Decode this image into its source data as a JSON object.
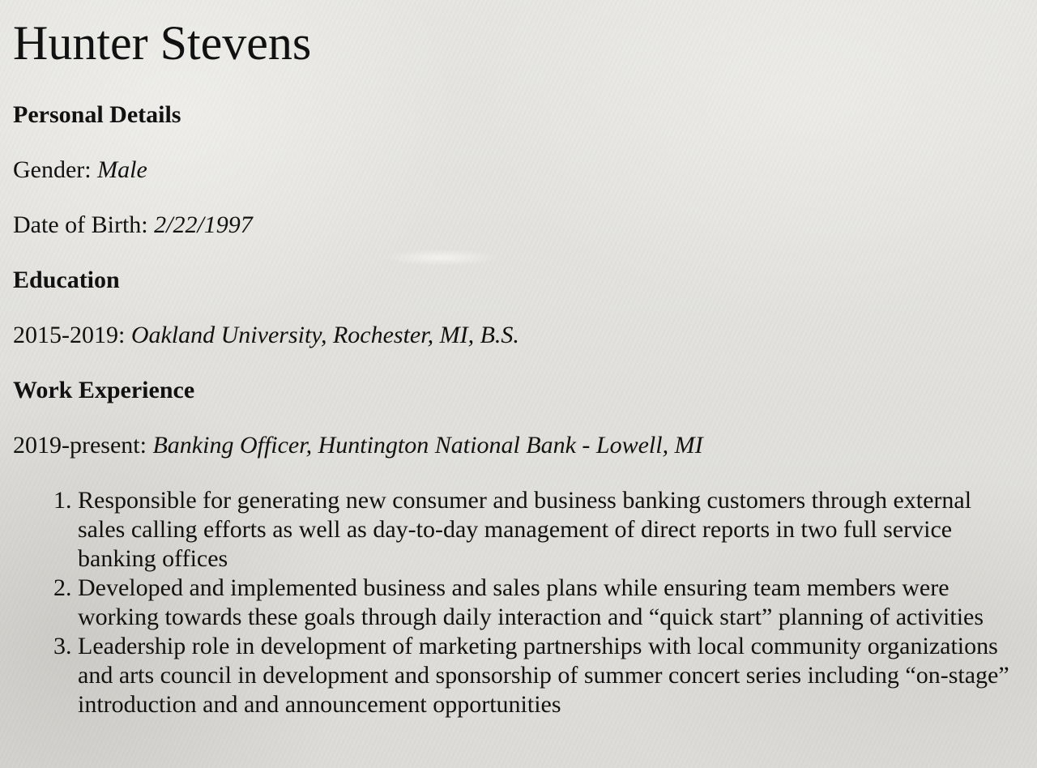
{
  "resume": {
    "name": "Hunter Stevens",
    "personal": {
      "heading": "Personal Details",
      "gender_label": "Gender:",
      "gender_value": "Male",
      "dob_label": "Date of Birth:",
      "dob_value": "2/22/1997"
    },
    "education": {
      "heading": "Education",
      "entries": [
        {
          "years": "2015-2019:",
          "detail": "Oakland University, Rochester, MI, B.S."
        }
      ]
    },
    "work": {
      "heading": "Work Experience",
      "entries": [
        {
          "years": "2019-present:",
          "position": "Banking Officer, Huntington National Bank",
          "separator": " - ",
          "location": "Lowell, MI",
          "duties": [
            "Responsible for generating new consumer and business banking customers through external sales calling efforts as well as day-to-day management of direct reports in two full service banking offices",
            "Developed and implemented business and sales plans while ensuring team members were working towards these goals through daily interaction and “quick start” planning of activities",
            "Leadership role in development of marketing partnerships with local community organizations and arts council in development and sponsorship of summer concert series including “on-stage” introduction and and announcement opportunities"
          ]
        }
      ]
    }
  }
}
